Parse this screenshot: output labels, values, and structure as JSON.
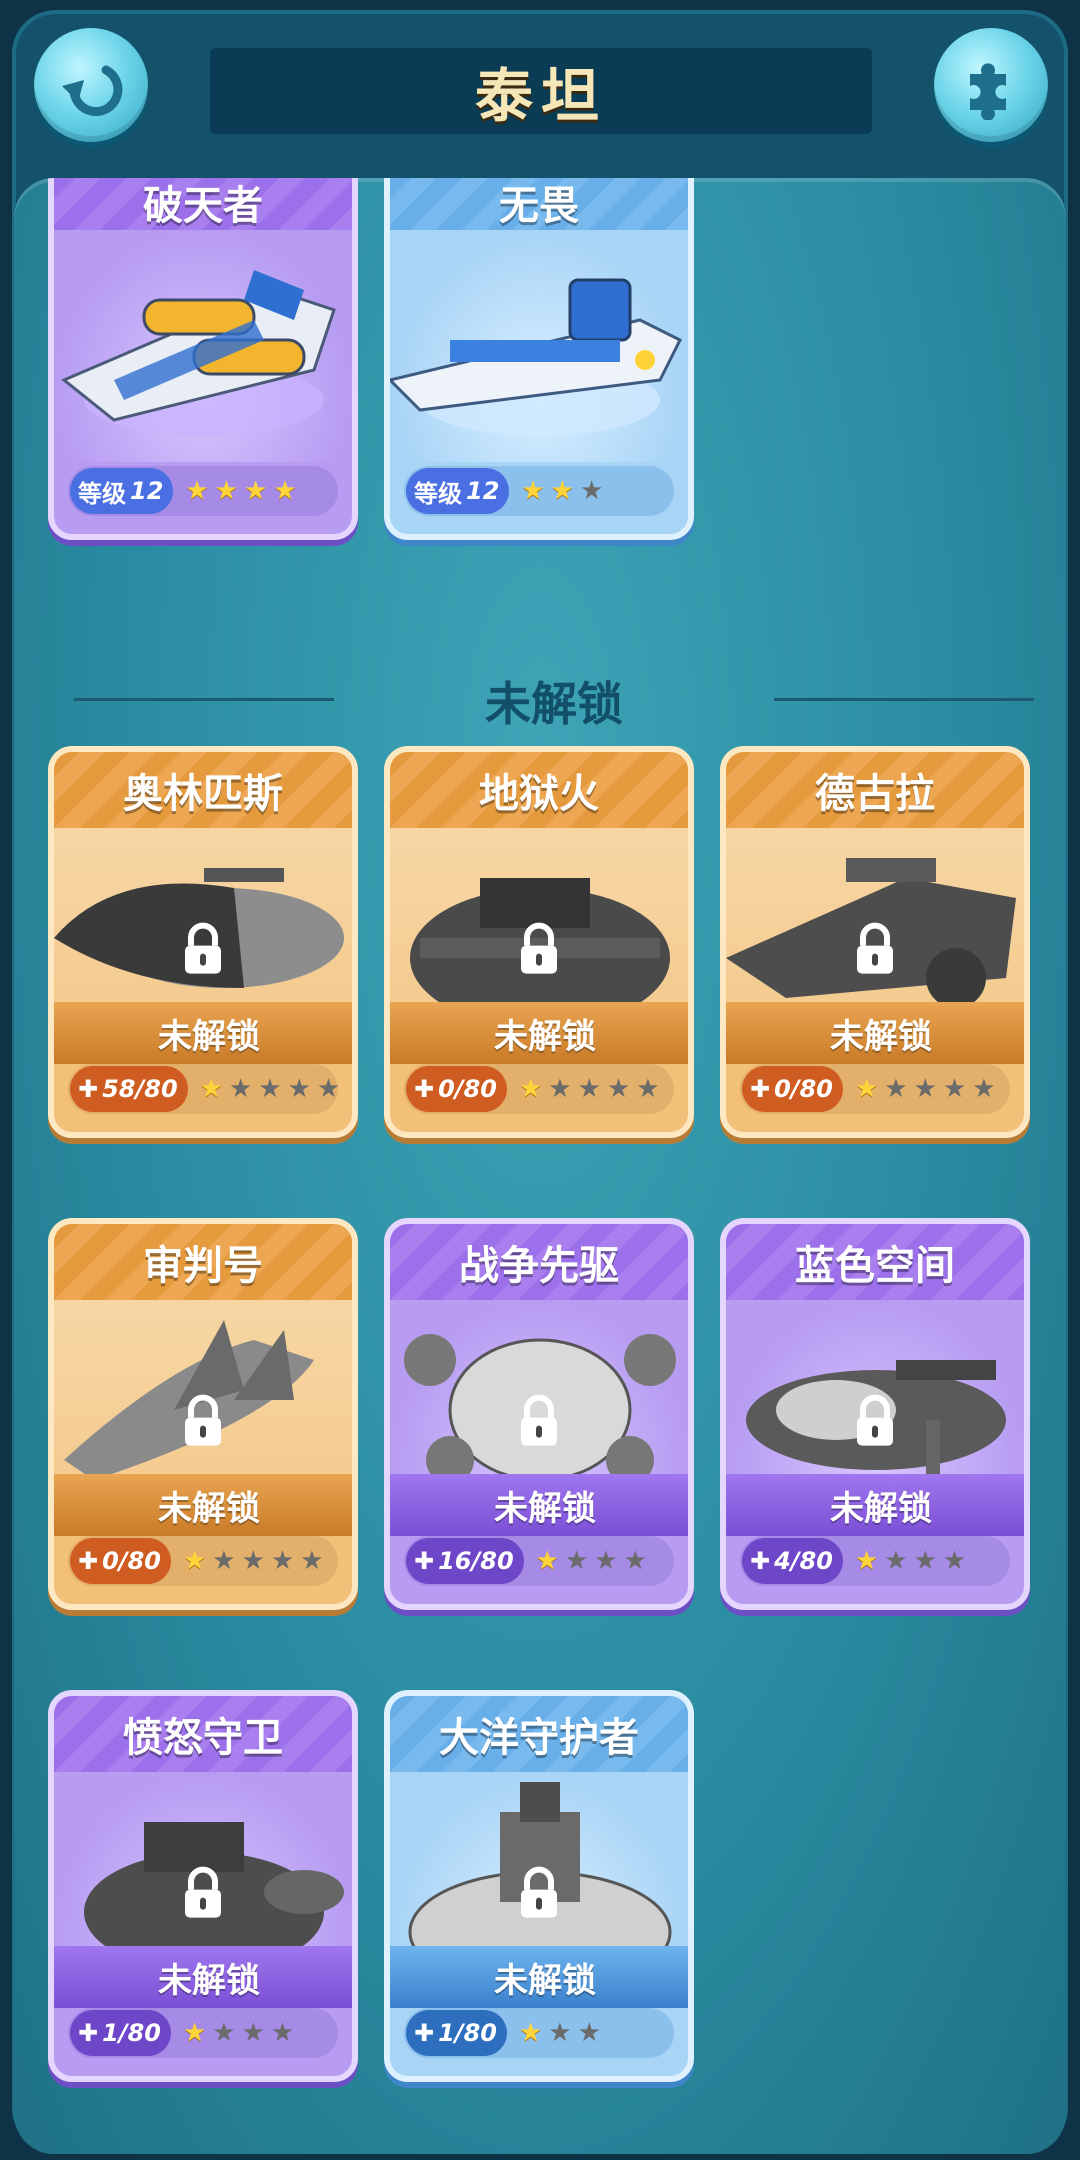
{
  "header": {
    "title": "泰坦",
    "back_icon": "back-arrow-icon",
    "puzzle_icon": "puzzle-icon"
  },
  "unlocked": [
    {
      "name": "破天者",
      "theme": "purple",
      "level_label": "等级",
      "level": "12",
      "stars": 4,
      "max_stars": 4
    },
    {
      "name": "无畏",
      "theme": "blue",
      "level_label": "等级",
      "level": "12",
      "stars": 2,
      "max_stars": 3
    }
  ],
  "section_label": "未解锁",
  "locked": [
    {
      "name": "奥林匹斯",
      "theme": "orange",
      "status": "未解锁",
      "progress": "58/80",
      "stars": 1,
      "max_stars": 5
    },
    {
      "name": "地狱火",
      "theme": "orange",
      "status": "未解锁",
      "progress": "0/80",
      "stars": 1,
      "max_stars": 5
    },
    {
      "name": "德古拉",
      "theme": "orange",
      "status": "未解锁",
      "progress": "0/80",
      "stars": 1,
      "max_stars": 5
    },
    {
      "name": "审判号",
      "theme": "orange",
      "status": "未解锁",
      "progress": "0/80",
      "stars": 1,
      "max_stars": 5
    },
    {
      "name": "战争先驱",
      "theme": "purple",
      "status": "未解锁",
      "progress": "16/80",
      "stars": 1,
      "max_stars": 4
    },
    {
      "name": "蓝色空间",
      "theme": "purple",
      "status": "未解锁",
      "progress": "4/80",
      "stars": 1,
      "max_stars": 4
    },
    {
      "name": "愤怒守卫",
      "theme": "purple",
      "status": "未解锁",
      "progress": "1/80",
      "stars": 1,
      "max_stars": 4
    },
    {
      "name": "大洋守护者",
      "theme": "blue",
      "status": "未解锁",
      "progress": "1/80",
      "stars": 1,
      "max_stars": 3
    }
  ],
  "colors": {
    "background": "#0f3346",
    "panel": "#2a8ca1",
    "star": "#ffd43b"
  }
}
